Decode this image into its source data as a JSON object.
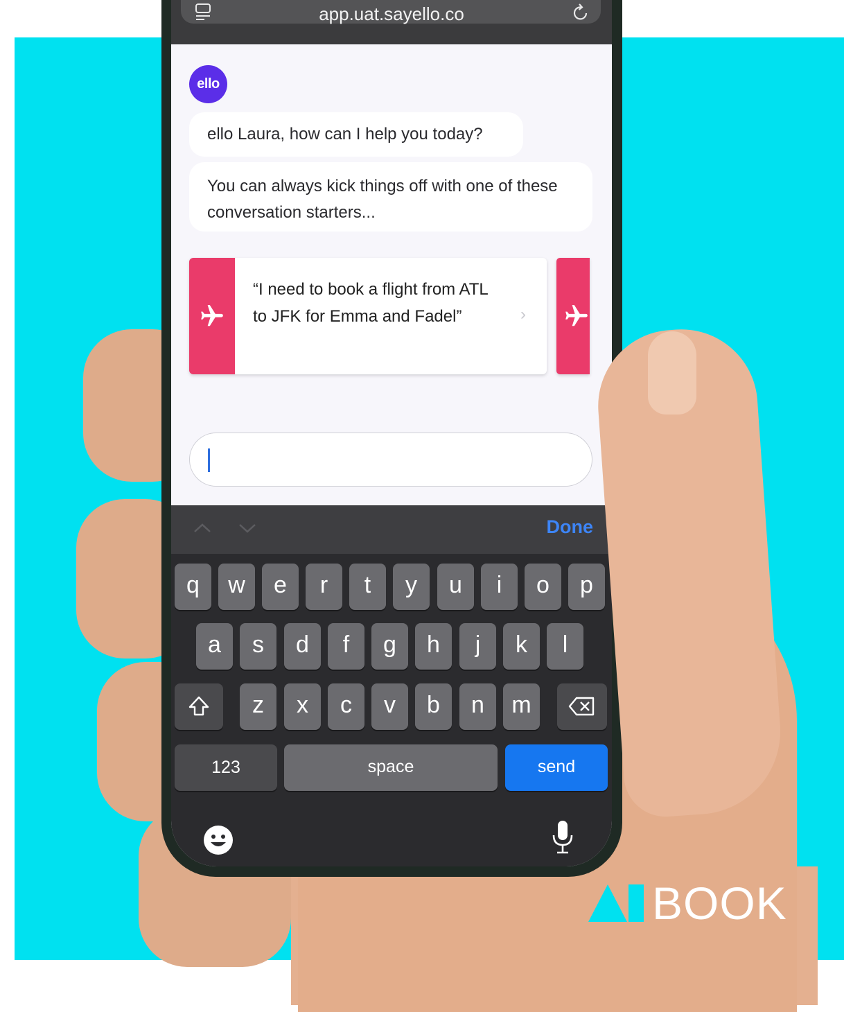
{
  "browser": {
    "url": "app.uat.sayello.co",
    "tab_icon": "tabs-icon",
    "reload_icon": "reload-icon"
  },
  "chat": {
    "avatar_label": "ello",
    "greeting": "ello Laura, how can I help you today?",
    "intro": "You can always kick things off with one of these conversation starters...",
    "starter_card": {
      "icon": "airplane-icon",
      "text": "“I need to book a flight from ATL to JFK for Emma and Fadel”"
    },
    "input_value": ""
  },
  "accessory_bar": {
    "done_label": "Done"
  },
  "keyboard": {
    "row1": [
      "q",
      "w",
      "e",
      "r",
      "t",
      "y",
      "u",
      "i",
      "o",
      "p"
    ],
    "row2": [
      "a",
      "s",
      "d",
      "f",
      "g",
      "h",
      "j",
      "k",
      "l"
    ],
    "row3": [
      "z",
      "x",
      "c",
      "v",
      "b",
      "n",
      "m"
    ],
    "numbers_label": "123",
    "space_label": "space",
    "send_label": "send"
  },
  "branding": {
    "logo_text": "BOOK"
  },
  "colors": {
    "background": "#00e1f0",
    "accent_pink": "#ea3b6a",
    "avatar_purple": "#5b2ee8",
    "send_blue": "#1677f0",
    "done_blue": "#3d85f7"
  }
}
